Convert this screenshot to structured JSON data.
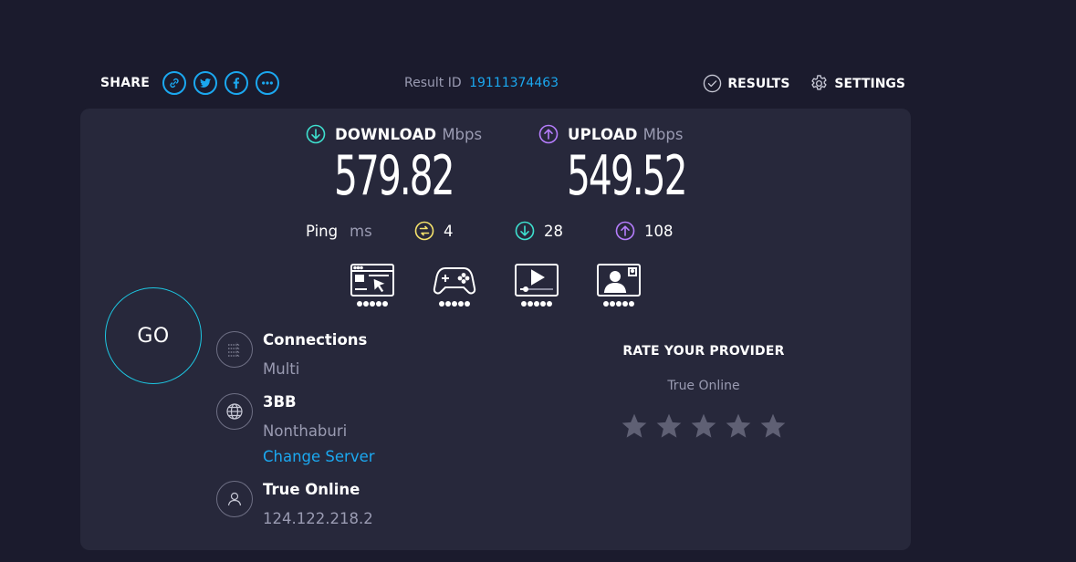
{
  "header": {
    "share_label": "SHARE",
    "share_buttons": [
      "link-icon",
      "twitter-icon",
      "facebook-icon",
      "more-icon"
    ],
    "result_id_label": "Result ID",
    "result_id_value": "19111374463",
    "results_label": "RESULTS",
    "settings_label": "SETTINGS"
  },
  "download": {
    "label": "DOWNLOAD",
    "unit": "Mbps",
    "value": "579.82"
  },
  "upload": {
    "label": "UPLOAD",
    "unit": "Mbps",
    "value": "549.52"
  },
  "ping": {
    "label": "Ping",
    "unit": "ms",
    "idle": "4",
    "download": "28",
    "upload": "108"
  },
  "experiences": [
    {
      "icon": "web-browsing-icon",
      "rating": 5
    },
    {
      "icon": "gaming-icon",
      "rating": 5
    },
    {
      "icon": "video-streaming-icon",
      "rating": 5
    },
    {
      "icon": "video-chat-icon",
      "rating": 5
    }
  ],
  "go_label": "GO",
  "connections": {
    "title": "Connections",
    "value": "Multi"
  },
  "server": {
    "name": "3BB",
    "location": "Nonthaburi",
    "change_label": "Change Server"
  },
  "provider": {
    "name": "True Online",
    "ip": "124.122.218.2"
  },
  "rate": {
    "title": "RATE YOUR PROVIDER",
    "isp": "True Online",
    "stars": 5
  },
  "colors": {
    "background": "#1b1b2d",
    "panel": "#27283b",
    "accent_blue": "#1ba8f0",
    "download_cyan": "#3ee0cf",
    "upload_purple": "#b57dfc",
    "ping_yellow": "#f5e26b",
    "go_ring": "#1dc7e2",
    "muted_text": "#9a9bb2",
    "star_gray": "#5f6074"
  }
}
